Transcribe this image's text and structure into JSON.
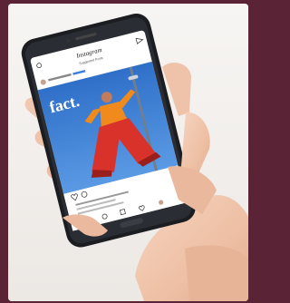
{
  "photo": {
    "subject": "hand-holding-smartphone",
    "app_icon": "instagram"
  },
  "instagram": {
    "app_title": "Instagram",
    "header_subtitle": "Suggested Posts",
    "post_brand_text": "fact."
  },
  "colors": {
    "frame": "#5a2436",
    "card_background": "#f4f1ee",
    "phone_body": "#1b1d21",
    "sky": "#3d7fd6",
    "outfit_orange": "#f08a1c",
    "outfit_red": "#d8322a",
    "skin": "#f0c6ad"
  }
}
